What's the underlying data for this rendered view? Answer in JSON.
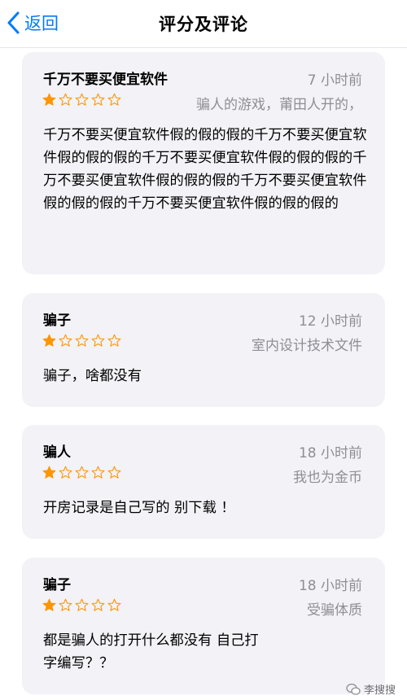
{
  "nav": {
    "back_label": "返回",
    "title": "评分及评论"
  },
  "reviews": [
    {
      "title": "千万不要买便宜软件",
      "time": "7 小时前",
      "rating": 1,
      "author": "骗人的游戏，莆田人开的，",
      "body": "千万不要买便宜软件假的假的假的千万不要买便宜软件假的假的假的千万不要买便宜软件假的假的假的千万不要买便宜软件假的假的假的千万不要买便宜软件假的假的假的千万不要买便宜软件假的假的假的"
    },
    {
      "title": "骗子",
      "time": "12 小时前",
      "rating": 1,
      "author": "室内设计技术文件",
      "body": "骗子，啥都没有"
    },
    {
      "title": "骗人",
      "time": "18 小时前",
      "rating": 1,
      "author": "我也为金币",
      "body": "开房记录是自己写的  别下载 ！"
    },
    {
      "title": "骗子",
      "time": "18 小时前",
      "rating": 1,
      "author": "受骗体质",
      "body": "都是骗人的打开什么都没有 自己打字编写？？"
    }
  ],
  "watermark": {
    "text": "李搜搜",
    "icon": "wechat-icon"
  },
  "colors": {
    "accent": "#007aff",
    "star": "#ff9500",
    "card_bg": "#f2f2f7",
    "secondary_text": "#8e8e93"
  }
}
